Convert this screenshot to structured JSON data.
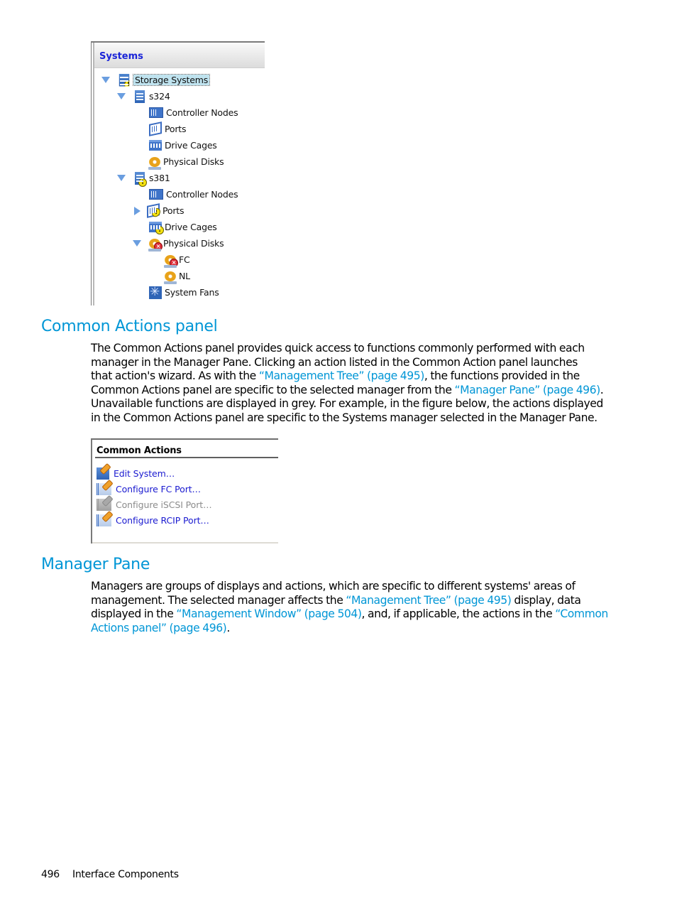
{
  "systems_tree": {
    "header": "Systems",
    "nodes": [
      {
        "label": "Storage Systems",
        "icon": "storage-systems-icon",
        "badge": "warning",
        "twisty": "open",
        "selected": true
      },
      {
        "label": "s324",
        "icon": "server-icon",
        "badge": "",
        "twisty": "open"
      },
      {
        "label": "Controller Nodes",
        "icon": "controller-nodes-icon",
        "badge": "",
        "twisty": ""
      },
      {
        "label": "Ports",
        "icon": "ports-icon",
        "badge": "",
        "twisty": ""
      },
      {
        "label": "Drive Cages",
        "icon": "drive-cages-icon",
        "badge": "",
        "twisty": ""
      },
      {
        "label": "Physical Disks",
        "icon": "physical-disks-icon",
        "badge": "",
        "twisty": ""
      },
      {
        "label": "s381",
        "icon": "server-icon",
        "badge": "warning",
        "twisty": "open"
      },
      {
        "label": "Controller Nodes",
        "icon": "controller-nodes-icon",
        "badge": "",
        "twisty": ""
      },
      {
        "label": "Ports",
        "icon": "ports-icon",
        "badge": "warning",
        "twisty": "closed"
      },
      {
        "label": "Drive Cages",
        "icon": "drive-cages-icon",
        "badge": "warning",
        "twisty": ""
      },
      {
        "label": "Physical Disks",
        "icon": "physical-disks-icon",
        "badge": "error",
        "twisty": "open"
      },
      {
        "label": "FC",
        "icon": "physical-disks-icon",
        "badge": "error",
        "twisty": ""
      },
      {
        "label": "NL",
        "icon": "physical-disks-icon",
        "badge": "",
        "twisty": ""
      },
      {
        "label": "System Fans",
        "icon": "system-fans-icon",
        "badge": "",
        "twisty": ""
      }
    ]
  },
  "section_common_actions": {
    "heading": "Common Actions panel",
    "paragraph": [
      [
        {
          "t": "The Common Actions panel provides quick access to functions commonly performed with each"
        }
      ],
      [
        {
          "t": "manager in the Manager Pane. Clicking an action listed in the Common Action panel launches"
        }
      ],
      [
        {
          "t": "that action's wizard. As with the "
        },
        {
          "t": "“Management Tree” (page 495)",
          "link": true
        },
        {
          "t": ", the functions provided in the"
        }
      ],
      [
        {
          "t": "Common Actions panel are specific to the selected manager from the "
        },
        {
          "t": "“Manager Pane” (page 496)",
          "link": true
        },
        {
          "t": "."
        }
      ],
      [
        {
          "t": "Unavailable functions are displayed in grey. For example, in the figure below, the actions displayed"
        }
      ],
      [
        {
          "t": "in the Common Actions panel are specific to the Systems manager selected in the Manager Pane."
        }
      ]
    ]
  },
  "common_actions_panel": {
    "title": "Common Actions",
    "items": [
      {
        "label": "Edit System...",
        "icon": "edit-system-icon",
        "enabled": true
      },
      {
        "label": "Configure FC Port...",
        "icon": "configure-port-icon",
        "enabled": true
      },
      {
        "label": "Configure iSCSI Port...",
        "icon": "configure-port-icon",
        "enabled": false
      },
      {
        "label": "Configure RCIP Port...",
        "icon": "configure-port-icon",
        "enabled": true
      }
    ]
  },
  "section_manager_pane": {
    "heading": "Manager Pane",
    "paragraph": [
      [
        {
          "t": "Managers are groups of displays and actions, which are specific to different systems' areas of"
        }
      ],
      [
        {
          "t": "management. The selected manager affects the "
        },
        {
          "t": "“Management Tree” (page 495)",
          "link": true
        },
        {
          "t": " display, data"
        }
      ],
      [
        {
          "t": "displayed in the "
        },
        {
          "t": "“Management Window” (page 504)",
          "link": true
        },
        {
          "t": ", and, if applicable, the actions in the "
        },
        {
          "t": "“Common",
          "link": true
        }
      ],
      [
        {
          "t": "Actions panel” (page 496)",
          "link": true
        },
        {
          "t": "."
        }
      ]
    ]
  },
  "footer": {
    "page_number": "496",
    "section": "Interface Components"
  },
  "colors": {
    "heading": "#0096d6",
    "link": "#0096d6",
    "action_link": "#1a1ad0",
    "action_disabled": "#8c8c8c",
    "tree_header": "#1a24d8"
  }
}
